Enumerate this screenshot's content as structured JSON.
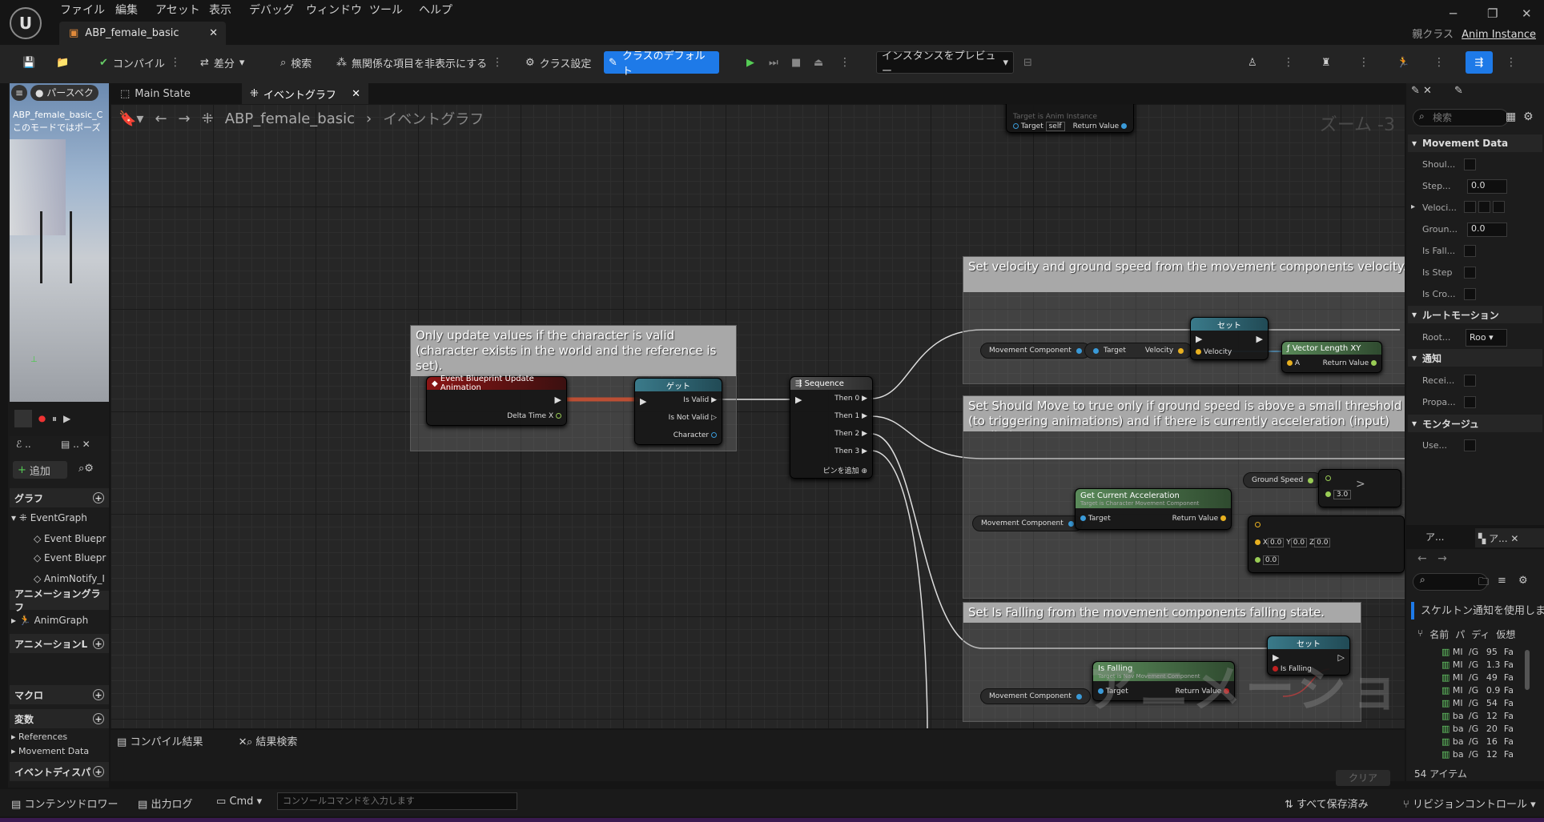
{
  "app": {
    "menus": [
      "ファイル",
      "編集",
      "アセット",
      "表示",
      "デバッグ",
      "ウィンドウ",
      "ツール",
      "ヘルプ"
    ],
    "tab_title": "ABP_female_basic",
    "parent_class_label": "親クラス",
    "parent_class_value": "Anim Instance"
  },
  "toolbar": {
    "compile": "コンパイル",
    "diff": "差分",
    "search": "検索",
    "hide_unrelated": "無関係な項目を非表示にする",
    "class_settings": "クラス設定",
    "class_defaults": "クラスのデフォルト",
    "preview_instance": "インスタンスをプレビュー"
  },
  "viewport": {
    "perspective": "パースペク",
    "asset": "ABP_female_basic_C",
    "mode_text": "このモードではポーズ"
  },
  "mybp": {
    "add": "追加",
    "graphs_header": "グラフ",
    "event_graph": "EventGraph",
    "event_items": [
      "Event Bluepr",
      "Event Bluepr",
      "AnimNotify_I"
    ],
    "anim_graphs_header": "アニメーショングラフ",
    "anim_graph": "AnimGraph",
    "anim_layers": "アニメーションL",
    "macros": "マクロ",
    "variables": "変数",
    "var_groups": [
      "References",
      "Movement Data"
    ],
    "event_dispatchers": "イベントディスパ"
  },
  "graph_tabs": {
    "main_state": "Main State",
    "event_graph": "イベントグラフ"
  },
  "breadcrumb": {
    "root": "ABP_female_basic",
    "current": "イベントグラフ",
    "zoom": "ズーム -3"
  },
  "watermark": "アニメーション",
  "comments": {
    "valid": "Only update values if the character is valid (character exists in the world and the reference is set).",
    "velocity": "Set velocity and ground speed from the movement components velocity. Gr calculated from only the X and Y axis of the velocity, so moving up or down",
    "should_move": "Set Should Move to true only if ground speed is above a small threshold (to triggering animations) and if there is currently acceleration (input) applied.",
    "falling": "Set Is Falling from the movement components falling state."
  },
  "nodes": {
    "event_update": "Event Blueprint Update Animation",
    "delta_time": "Delta Time X",
    "get": "ゲット",
    "is_valid": "Is Valid",
    "is_not_valid": "Is Not Valid",
    "character": "Character",
    "sequence": "Sequence",
    "then_pins": [
      "Then 0",
      "Then 1",
      "Then 2",
      "Then 3"
    ],
    "add_pin": "ピンを追加",
    "set": "セット",
    "velocity": "Velocity",
    "target": "Target",
    "movement_component": "Movement Component",
    "vector_length_xy": "Vector Length XY",
    "a": "A",
    "return_value": "Return Value",
    "get_current_acceleration": "Get Current Acceleration",
    "target_char_move": "Target is Character Movement Component",
    "target_nav_move": "Target is Nav Movement Component",
    "ground_speed": "Ground Speed",
    "threshold": "3.0",
    "is_falling": "Is Falling",
    "x": "X",
    "y": "Y",
    "z": "Z",
    "zero": "0.0",
    "self": "self",
    "target_anim_instance": "Target is Anim Instance"
  },
  "bottom": {
    "compile_results": "コンパイル結果",
    "find_results": "結果検索",
    "clear": "クリア"
  },
  "details": {
    "search_placeholder": "検索",
    "movement_data": "Movement Data",
    "rows": [
      "Shoul...",
      "Step...",
      "Veloci...",
      "Groun...",
      "Is Fall...",
      "Is Step",
      "Is Cro..."
    ],
    "step_value": "0.0",
    "ground_value": "0.0",
    "root_motion": "ルートモーション",
    "root_label": "Root...",
    "root_value": "Roo",
    "notify": "通知",
    "notify_rows": [
      "Recei...",
      "Propa..."
    ],
    "montage": "モンタージュ",
    "montage_row": "Use..."
  },
  "asset_browser": {
    "tab_a": "ア...",
    "tab_b": "ア...",
    "skeleton_notify": "スケルトン通知を使用しま",
    "columns": [
      "名前",
      "パ",
      "ディ",
      "仮想"
    ],
    "rows": [
      [
        "MI",
        "/G",
        "95",
        "Fa"
      ],
      [
        "MI",
        "/G",
        "1.3",
        "Fa"
      ],
      [
        "MI",
        "/G",
        "49",
        "Fa"
      ],
      [
        "MI",
        "/G",
        "0.9",
        "Fa"
      ],
      [
        "MI",
        "/G",
        "54",
        "Fa"
      ],
      [
        "ba",
        "/G",
        "12",
        "Fa"
      ],
      [
        "ba",
        "/G",
        "20",
        "Fa"
      ],
      [
        "ba",
        "/G",
        "16",
        "Fa"
      ],
      [
        "ba",
        "/G",
        "12",
        "Fa"
      ]
    ],
    "count": "54 アイテム"
  },
  "statusbar": {
    "content_drawer": "コンテンツドロワー",
    "output_log": "出力ログ",
    "cmd": "Cmd",
    "console_placeholder": "コンソールコマンドを入力します",
    "save_all": "すべて保存済み",
    "revision": "リビジョンコントロール"
  }
}
